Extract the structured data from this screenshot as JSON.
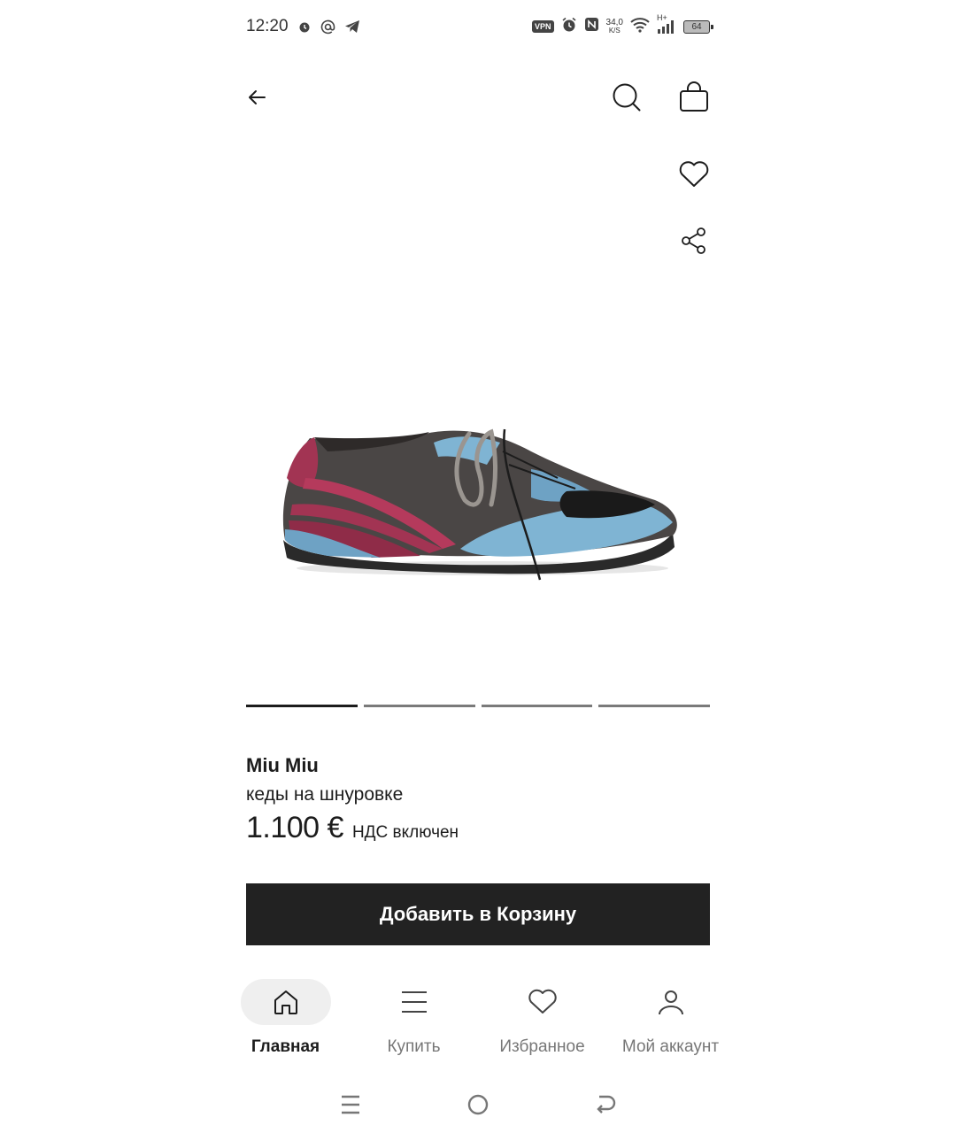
{
  "status_bar": {
    "time": "12:20",
    "vpn": "VPN",
    "speed_value": "34,0",
    "speed_unit": "K/S",
    "network": "H+",
    "battery": "64"
  },
  "colors": {
    "primary_button": "#222222",
    "active_indicator": "#1c1c1c",
    "inactive_indicator": "#7a7a7a",
    "active_tab_bg": "#efefef"
  },
  "carousel": {
    "count": 4,
    "active_index": 0
  },
  "product": {
    "brand": "Miu Miu",
    "name": "кеды на шнуровке",
    "price": "1.100 €",
    "vat_note": "НДС включен"
  },
  "add_to_cart_label": "Добавить в Корзину",
  "bottom_nav": [
    {
      "label": "Главная",
      "icon": "home-icon",
      "active": true
    },
    {
      "label": "Купить",
      "icon": "menu-icon",
      "active": false
    },
    {
      "label": "Избранное",
      "icon": "heart-icon",
      "active": false
    },
    {
      "label": "Мой аккаунт",
      "icon": "user-icon",
      "active": false
    }
  ]
}
